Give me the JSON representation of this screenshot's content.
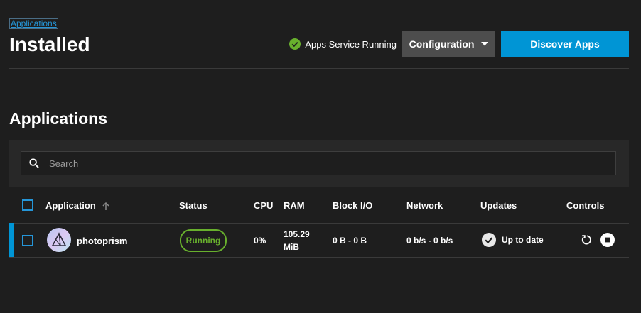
{
  "breadcrumb": "Applications",
  "page_title": "Installed",
  "header": {
    "service_status": "Apps Service Running",
    "config_label": "Configuration",
    "discover_label": "Discover Apps"
  },
  "section_title": "Applications",
  "search": {
    "placeholder": "Search",
    "value": ""
  },
  "table": {
    "columns": {
      "application": "Application",
      "status": "Status",
      "cpu": "CPU",
      "ram": "RAM",
      "block_io": "Block I/O",
      "network": "Network",
      "updates": "Updates",
      "controls": "Controls"
    },
    "rows": [
      {
        "name": "photoprism",
        "status": "Running",
        "cpu": "0%",
        "ram": "105.29 MiB",
        "block_io": "0 B - 0 B",
        "network": "0 b/s - 0 b/s",
        "updates": "Up to date"
      }
    ]
  },
  "colors": {
    "accent": "#0095d5",
    "running": "#68b02d",
    "link": "#2596d8",
    "background": "#1e1e1e"
  },
  "icons": {
    "service_status": "check-circle-icon",
    "config_dropdown": "caret-down-icon",
    "search": "search-icon",
    "sort": "arrow-up-icon",
    "app": "photoprism-logo-icon",
    "updates": "check-circle-icon",
    "restart": "restart-icon",
    "stop": "stop-icon"
  }
}
